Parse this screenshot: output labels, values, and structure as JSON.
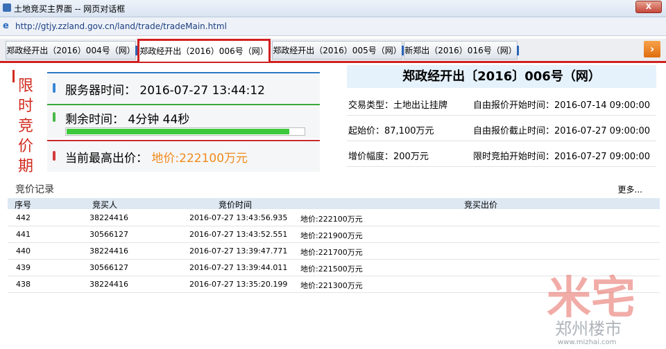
{
  "window": {
    "title": "土地竞买主界面 -- 网页对话框",
    "close_label": "X"
  },
  "address": {
    "url": "http://gtjy.zzland.gov.cn/land/trade/tradeMain.html"
  },
  "tabs": [
    {
      "label": "郑政经开出（2016）004号（网）"
    },
    {
      "label": "郑政经开出（2016）006号（网）"
    },
    {
      "label": "郑政经开出（2016）005号（网）"
    },
    {
      "label": "新郑出（2016）016号（网）"
    }
  ],
  "tab_next": "›",
  "phase": {
    "chars": [
      "限",
      "时",
      "竞",
      "价",
      "期"
    ]
  },
  "status": {
    "server_time_label": "服务器时间：",
    "server_time": "2016-07-27 13:44:12",
    "remaining_label": "剩余时间：",
    "remaining": "4分钟 44秒",
    "remaining_fraction": 0.94,
    "highest_label": "当前最高出价：",
    "highest": "地价:222100万元"
  },
  "notice": {
    "title": "郑政经开出〔2016〕006号（网）",
    "rows": [
      {
        "left": "交易类型：土地出让挂牌",
        "right": "自由报价开始时间：2016-07-14 09:00:00"
      },
      {
        "left": "起始价：87,100万元",
        "right": "自由报价截止时间：2016-07-27 09:00:00"
      },
      {
        "left": "增价幅度：200万元",
        "right": "限时竞拍开始时间：2016-07-27 09:00:00"
      }
    ]
  },
  "records": {
    "title": "竞价记录",
    "more": "更多...",
    "headers": [
      "序号",
      "竞买人",
      "竞价时间",
      "竞买出价"
    ],
    "rows": [
      [
        "442",
        "38224416",
        "2016-07-27 13:43:56.935",
        "地价:222100万元"
      ],
      [
        "441",
        "30566127",
        "2016-07-27 13:43:52.551",
        "地价:221900万元"
      ],
      [
        "440",
        "38224416",
        "2016-07-27 13:39:47.771",
        "地价:221700万元"
      ],
      [
        "439",
        "30566127",
        "2016-07-27 13:39:44.011",
        "地价:221500万元"
      ],
      [
        "438",
        "38224416",
        "2016-07-27 13:35:20.199",
        "地价:221300万元"
      ]
    ]
  },
  "watermark": {
    "big": "米宅",
    "small": "郑州楼市",
    "site": "www.mizhai.com"
  },
  "colors": {
    "accent_red": "#d02020",
    "progress_green": "#3cc93c",
    "price_orange": "#f08a1c"
  }
}
